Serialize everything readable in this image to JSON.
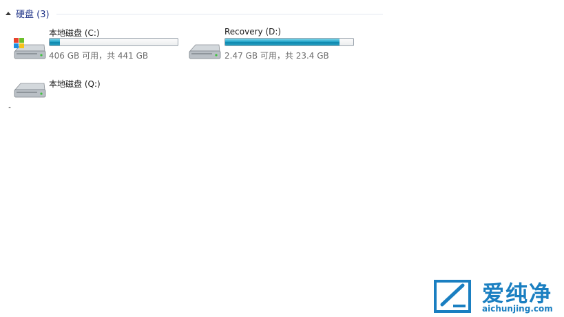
{
  "group": {
    "title": "硬盘 (3)"
  },
  "drives": [
    {
      "name": "本地磁盘 (C:)",
      "info": "406 GB 可用，共 441 GB",
      "used_fraction": 0.08,
      "icon": "windows-drive-icon"
    },
    {
      "name": "Recovery (D:)",
      "info": "2.47 GB 可用，共 23.4 GB",
      "used_fraction": 0.89,
      "icon": "hard-drive-icon"
    },
    {
      "name": "本地磁盘 (Q:)",
      "icon": "hard-drive-icon"
    }
  ],
  "colors": {
    "accent": "#1e3287",
    "bar_fill": "#1a9cc4",
    "watermark": "#1a7fc1"
  },
  "watermark": {
    "brand": "爱纯净",
    "url": "aichunjing.com"
  }
}
